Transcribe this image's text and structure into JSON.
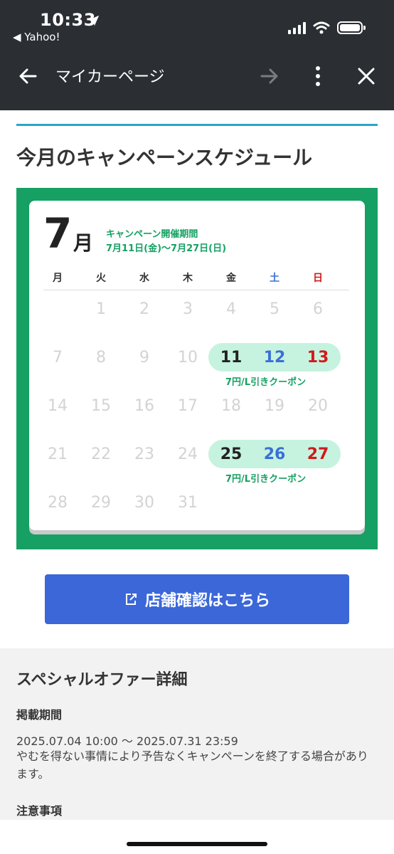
{
  "status_bar": {
    "time": "10:33",
    "back_app": "◀ Yahoo!"
  },
  "nav": {
    "title": "マイカーページ"
  },
  "page": {
    "heading": "今月のキャンペーンスケジュール"
  },
  "calendar": {
    "month_number": "7",
    "month_suffix": "月",
    "period_title": "キャンペーン開催期間",
    "period_dates": "7月11日(金)〜7月27日(日)",
    "weekdays": [
      "月",
      "火",
      "水",
      "木",
      "金",
      "土",
      "日"
    ],
    "weeks": [
      [
        "",
        "1",
        "2",
        "3",
        "4",
        "5",
        "6"
      ],
      [
        "7",
        "8",
        "9",
        "10",
        "11",
        "12",
        "13"
      ],
      [
        "14",
        "15",
        "16",
        "17",
        "18",
        "19",
        "20"
      ],
      [
        "21",
        "22",
        "23",
        "24",
        "25",
        "26",
        "27"
      ],
      [
        "28",
        "29",
        "30",
        "31",
        "",
        "",
        ""
      ]
    ],
    "highlighted_days": [
      "11",
      "12",
      "13",
      "25",
      "26",
      "27"
    ],
    "coupon_label": "7円/L引きクーポン",
    "colors": {
      "frame": "#16a063",
      "pill": "#c5f3e0",
      "saturday": "#3b6fd6",
      "sunday": "#d11a1a"
    }
  },
  "store_button": {
    "label": "店舗確認はこちら",
    "icon": "external-link-icon",
    "color": "#3b67d9"
  },
  "offer": {
    "title": "スペシャルオファー詳細",
    "period_label": "掲載期間",
    "period_value": "2025.07.04 10:00 〜 2025.07.31 23:59",
    "period_note": "やむを得ない事情により予告なくキャンペーンを終了する場合があります。",
    "notes_label": "注意事項"
  }
}
